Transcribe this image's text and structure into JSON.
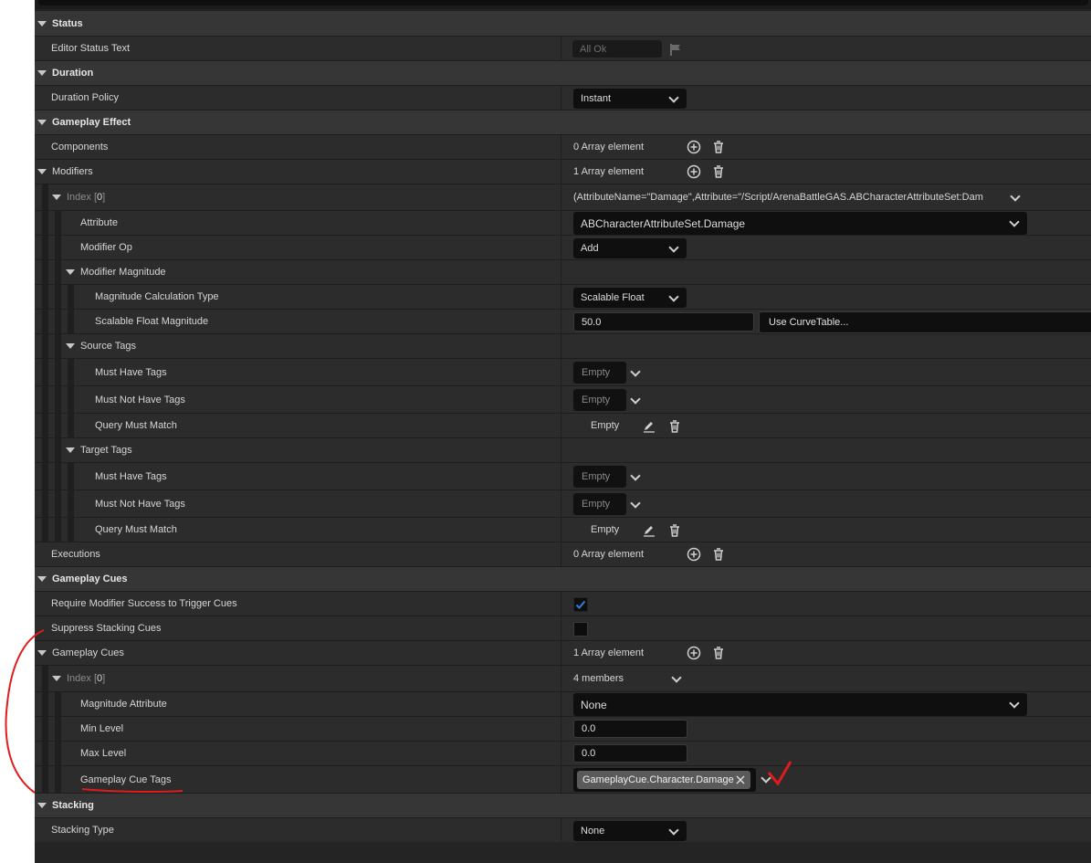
{
  "categories": {
    "status": "Status",
    "duration": "Duration",
    "gameplay_effect": "Gameplay Effect",
    "gameplay_cues": "Gameplay Cues",
    "stacking": "Stacking"
  },
  "rows": {
    "editor_status_text": {
      "label": "Editor Status Text",
      "value": "All Ok"
    },
    "duration_policy": {
      "label": "Duration Policy",
      "value": "Instant"
    },
    "components": {
      "label": "Components",
      "value": "0 Array element"
    },
    "modifiers": {
      "label": "Modifiers",
      "value": "1 Array element"
    },
    "modifier_index": {
      "label_prefix": "Index [",
      "index": "0",
      "label_suffix": "]",
      "value": "(AttributeName=\"Damage\",Attribute=\"/Script/ArenaBattleGAS.ABCharacterAttributeSet:Dam"
    },
    "attribute": {
      "label": "Attribute",
      "value": "ABCharacterAttributeSet.Damage"
    },
    "modifier_op": {
      "label": "Modifier Op",
      "value": "Add"
    },
    "modifier_magnitude": {
      "label": "Modifier Magnitude"
    },
    "magnitude_calc_type": {
      "label": "Magnitude Calculation Type",
      "value": "Scalable Float"
    },
    "scalable_float_magnitude": {
      "label": "Scalable Float Magnitude",
      "value": "50.0",
      "curve_table": "Use CurveTable..."
    },
    "source_tags": {
      "label": "Source Tags"
    },
    "src_must_have": {
      "label": "Must Have Tags",
      "value": "Empty"
    },
    "src_must_not_have": {
      "label": "Must Not Have Tags",
      "value": "Empty"
    },
    "src_query": {
      "label": "Query Must Match",
      "value": "Empty"
    },
    "target_tags": {
      "label": "Target Tags"
    },
    "tgt_must_have": {
      "label": "Must Have Tags",
      "value": "Empty"
    },
    "tgt_must_not_have": {
      "label": "Must Not Have Tags",
      "value": "Empty"
    },
    "tgt_query": {
      "label": "Query Must Match",
      "value": "Empty"
    },
    "executions": {
      "label": "Executions",
      "value": "0 Array element"
    },
    "require_modifier_success": {
      "label": "Require Modifier Success to Trigger Cues",
      "checked": true
    },
    "suppress_stacking_cues": {
      "label": "Suppress Stacking Cues",
      "checked": false
    },
    "gameplay_cues_array": {
      "label": "Gameplay Cues",
      "value": "1 Array element"
    },
    "cue_index": {
      "label_prefix": "Index [",
      "index": "0",
      "label_suffix": "]",
      "value": "4 members"
    },
    "magnitude_attribute": {
      "label": "Magnitude Attribute",
      "value": "None"
    },
    "min_level": {
      "label": "Min Level",
      "value": "0.0"
    },
    "max_level": {
      "label": "Max Level",
      "value": "0.0"
    },
    "gameplay_cue_tags": {
      "label": "Gameplay Cue Tags",
      "tag": "GameplayCue.Character.Damage"
    },
    "stacking_type": {
      "label": "Stacking Type",
      "value": "None"
    }
  },
  "icons": [
    "add-icon",
    "trash-icon",
    "edit-icon",
    "flag-icon",
    "chevron-down-icon",
    "close-icon",
    "checkmark-icon",
    "collapse-triangle-icon"
  ],
  "colors": {
    "panel": "#242424",
    "row": "#2c2c2c",
    "category": "#363636",
    "field": "#0f0f0f",
    "checkbox_accent": "#2f7fd6",
    "annotation": "#e01b1b"
  }
}
